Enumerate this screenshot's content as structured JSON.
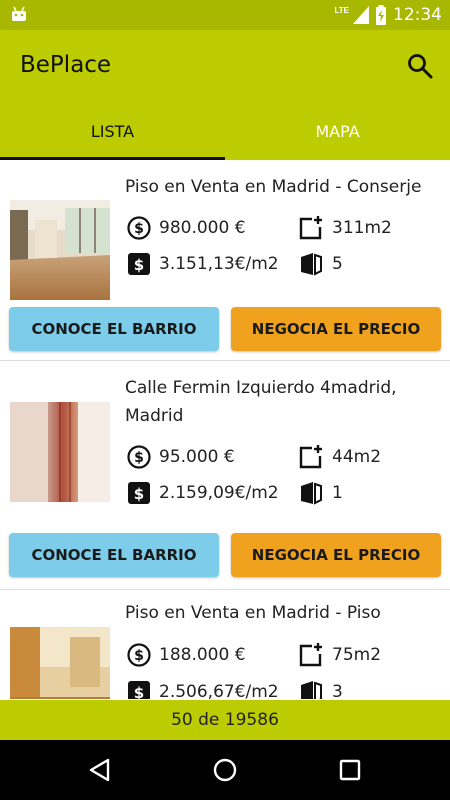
{
  "status_bar": {
    "time": "12:34",
    "network": "LTE",
    "icons": [
      "android-icon",
      "lte-signal-icon",
      "battery-icon"
    ]
  },
  "app_bar": {
    "title": "BePlace",
    "search_icon": "search-icon"
  },
  "tabs": [
    {
      "label": "LISTA",
      "active": true
    },
    {
      "label": "MAPA",
      "active": false
    }
  ],
  "listings": [
    {
      "title": "Piso en Venta en Madrid - Conserje",
      "price": "980.000 €",
      "area": "311m2",
      "price_per_m2": "3.151,13€/m2",
      "floor": "5"
    },
    {
      "title": "Calle Fermin Izquierdo 4madrid, Madrid",
      "price": "95.000 €",
      "area": "44m2",
      "price_per_m2": "2.159,09€/m2",
      "floor": "1"
    },
    {
      "title": "Piso en Venta en Madrid - Piso",
      "price": "188.000 €",
      "area": "75m2",
      "price_per_m2": "2.506,67€/m2",
      "floor": "3"
    }
  ],
  "buttons": {
    "barrio": "CONOCE EL BARRIO",
    "precio": "NEGOCIA EL PRECIO"
  },
  "footer": {
    "count": "50 de 19586"
  },
  "colors": {
    "primary": "#bccc00",
    "status_bar": "#a8b800",
    "barrio_button": "#7dcdea",
    "precio_button": "#f0a21e"
  }
}
